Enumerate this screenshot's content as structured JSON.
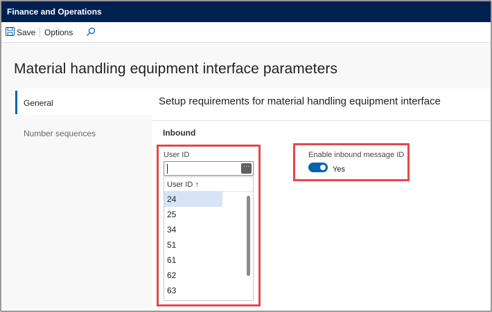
{
  "app": {
    "title": "Finance and Operations"
  },
  "toolbar": {
    "save_label": "Save",
    "options_label": "Options",
    "search_icon": "search-icon",
    "save_icon": "save-icon"
  },
  "page": {
    "title": "Material handling equipment interface parameters"
  },
  "tabs": [
    {
      "label": "General",
      "active": true
    },
    {
      "label": "Number sequences",
      "active": false
    }
  ],
  "section": {
    "title": "Setup requirements for material handling equipment interface",
    "group": "Inbound"
  },
  "user_id": {
    "label": "User ID",
    "value": "",
    "lookup": {
      "column_header": "User ID",
      "sort_indicator": "↑",
      "rows": [
        "24",
        "25",
        "34",
        "51",
        "61",
        "62",
        "63"
      ],
      "selected_index": 0
    }
  },
  "inbound_message_id": {
    "label": "Enable inbound message ID",
    "value": "Yes",
    "enabled": true
  },
  "colors": {
    "nav": "#002050",
    "accent": "#0063b1",
    "highlight": "#e0484e",
    "selected_row": "#d6e4f6"
  }
}
